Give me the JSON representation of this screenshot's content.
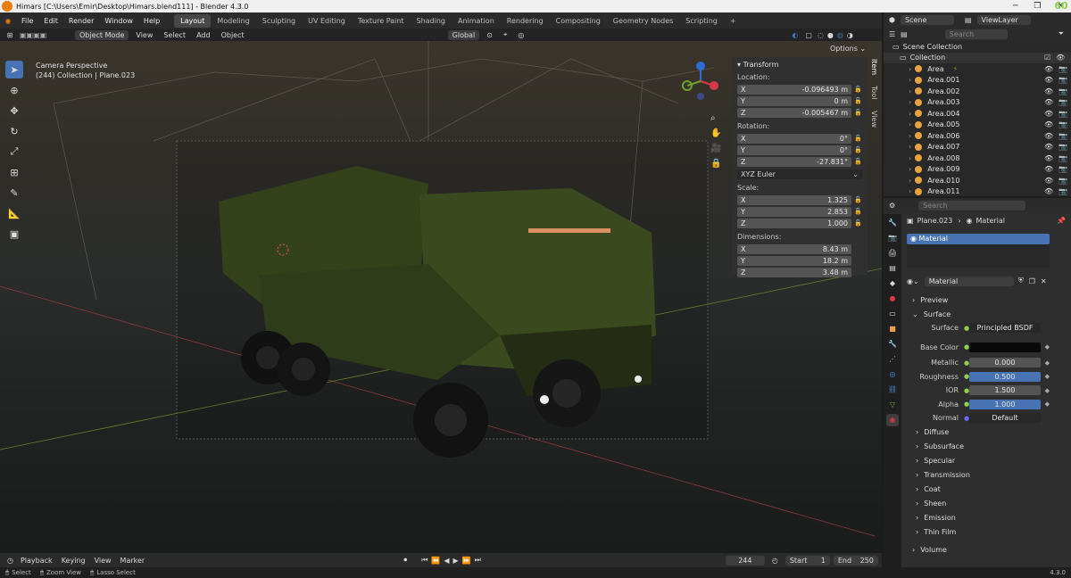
{
  "title": "Himars [C:\\Users\\Emir\\Desktop\\Himars.blend111] - Blender 4.3.0",
  "badge": "60",
  "menu": [
    "File",
    "Edit",
    "Render",
    "Window",
    "Help"
  ],
  "workspaces": [
    "Layout",
    "Modeling",
    "Sculpting",
    "UV Editing",
    "Texture Paint",
    "Shading",
    "Animation",
    "Rendering",
    "Compositing",
    "Geometry Nodes",
    "Scripting"
  ],
  "active_workspace": "Layout",
  "scene": "Scene",
  "view_layer": "ViewLayer",
  "viewport_header": {
    "mode": "Object Mode",
    "view": "View",
    "select": "Select",
    "add": "Add",
    "object": "Object",
    "orientation": "Global",
    "options": "Options"
  },
  "viewport_info": {
    "line1": "Camera Perspective",
    "line2": "(244) Collection | Plane.023"
  },
  "npanel": {
    "header": "Transform",
    "location_label": "Location:",
    "location": [
      {
        "axis": "X",
        "value": "-0.096493 m"
      },
      {
        "axis": "Y",
        "value": "0 m"
      },
      {
        "axis": "Z",
        "value": "-0.005467 m"
      }
    ],
    "rotation_label": "Rotation:",
    "rotation": [
      {
        "axis": "X",
        "value": "0°"
      },
      {
        "axis": "Y",
        "value": "0°"
      },
      {
        "axis": "Z",
        "value": "-27.831°"
      }
    ],
    "rotation_mode": "XYZ Euler",
    "scale_label": "Scale:",
    "scale": [
      {
        "axis": "X",
        "value": "1.325"
      },
      {
        "axis": "Y",
        "value": "2.853"
      },
      {
        "axis": "Z",
        "value": "1.000"
      }
    ],
    "dimensions_label": "Dimensions:",
    "dimensions": [
      {
        "axis": "X",
        "value": "8.43 m"
      },
      {
        "axis": "Y",
        "value": "18.2 m"
      },
      {
        "axis": "Z",
        "value": "3.48 m"
      }
    ],
    "tabs": [
      "Item",
      "Tool",
      "View"
    ]
  },
  "outliner": {
    "search_placeholder": "Search",
    "root": "Scene Collection",
    "collection": "Collection",
    "items": [
      "Area",
      "Area.001",
      "Area.002",
      "Area.003",
      "Area.004",
      "Area.005",
      "Area.006",
      "Area.007",
      "Area.008",
      "Area.009",
      "Area.010",
      "Area.011"
    ]
  },
  "properties": {
    "search_placeholder": "Search",
    "object": "Plane.023",
    "crumb": "Material",
    "slot": "Material",
    "material_name": "Material",
    "sections": {
      "preview": "Preview",
      "surface": "Surface"
    },
    "surface_label": "Surface",
    "surface_value": "Principled BSDF",
    "fields": [
      {
        "label": "Base Color",
        "value": "",
        "color": "#0a0a0a"
      },
      {
        "label": "Metallic",
        "value": "0.000",
        "fill": 0
      },
      {
        "label": "Roughness",
        "value": "0.500",
        "fill": 1
      },
      {
        "label": "IOR",
        "value": "1.500",
        "fill": 0
      },
      {
        "label": "Alpha",
        "value": "1.000",
        "fill": 1
      }
    ],
    "normal_label": "Normal",
    "normal_value": "Default",
    "subsections": [
      "Diffuse",
      "Subsurface",
      "Specular",
      "Transmission",
      "Coat",
      "Sheen",
      "Emission",
      "Thin Film"
    ],
    "volume": "Volume"
  },
  "timeline": {
    "playback": "Playback",
    "keying": "Keying",
    "view": "View",
    "marker": "Marker",
    "current": "244",
    "start_label": "Start",
    "start": "1",
    "end_label": "End",
    "end": "250"
  },
  "status": {
    "select": "Select",
    "zoom": "Zoom View",
    "lasso": "Lasso Select",
    "version": "4.3.0"
  },
  "colors": {
    "accent": "#4772b3",
    "blender_orange": "#e87d0d",
    "truck_green": "#3b4a1e"
  }
}
